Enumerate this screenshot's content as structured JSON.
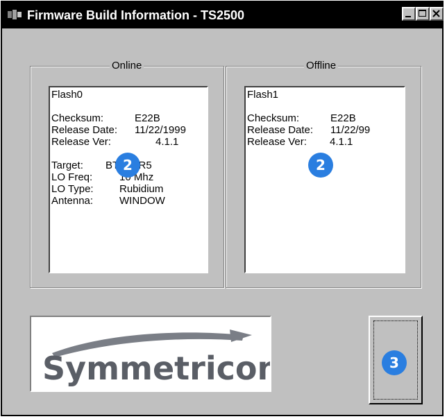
{
  "window": {
    "title": "Firmware Build Information - TS2500",
    "controls": {
      "minimize": "minimize",
      "maximize": "maximize",
      "close": "close"
    }
  },
  "online": {
    "legend": "Online",
    "lines": {
      "flash": "Flash0",
      "checksum_label": "Checksum:",
      "checksum_value": "E22B",
      "release_date_label": "Release Date:",
      "release_date_value": "11/22/1999",
      "release_ver_label": "Release Ver:",
      "release_ver_value": "4.1.1",
      "target_label": "Target:",
      "target_value": "BTS_XR5",
      "lo_freq_label": "LO Freq:",
      "lo_freq_value": "10 Mhz",
      "lo_type_label": "LO Type:",
      "lo_type_value": "Rubidium",
      "antenna_label": "Antenna:",
      "antenna_value": "WINDOW"
    },
    "badge": "2"
  },
  "offline": {
    "legend": "Offline",
    "lines": {
      "flash": "Flash1",
      "checksum_label": "Checksum:",
      "checksum_value": "E22B",
      "release_date_label": "Release Date:",
      "release_date_value": "11/22/99",
      "release_ver_label": "Release Ver:",
      "release_ver_value": "4.1.1"
    },
    "badge": "2"
  },
  "logo": {
    "text": "Symmetricom",
    "colors": {
      "text": "#5a5e66",
      "swoosh": "#7a7e86"
    }
  },
  "ok_button": {
    "badge": "3"
  },
  "colors": {
    "face": "#c0c0c0",
    "titlebar": "#000000",
    "badge": "#2a7ee0"
  }
}
